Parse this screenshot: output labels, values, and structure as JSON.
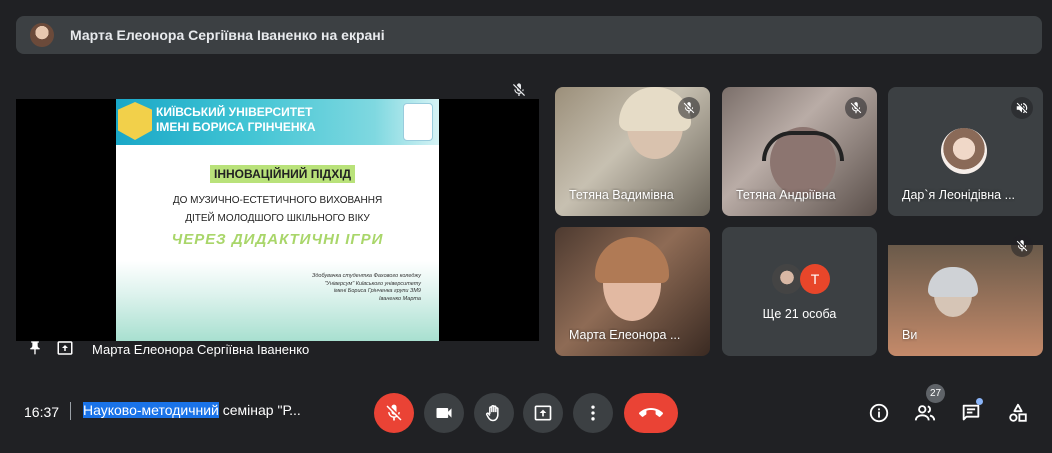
{
  "banner": {
    "text": "Марта Елеонора Сергіївна Іваненко на екрані"
  },
  "presentation": {
    "presenter_name": "Марта Елеонора Сергіївна Іваненко",
    "slide": {
      "university_line1": "КИЇВСЬКИЙ УНІВЕРСИТЕТ",
      "university_line2": "ІМЕНІ БОРИСА ГРІНЧЕНКА",
      "title": "ІННОВАЦІЙНИЙ ПІДХІД",
      "line1": "ДО МУЗИЧНО-ЕСТЕТИЧНОГО ВИХОВАННЯ",
      "line2": "ДІТЕЙ МОЛОДШОГО ШКІЛЬНОГО ВІКУ",
      "highlight": "ЧЕРЕЗ ДИДАКТИЧНІ ІГРИ",
      "note": "Здобувачка студентка Фахового коледжу \"Універсум\" Київського університету імені Бориса Грінченка групи ЗМ9 Іваненко Марта"
    }
  },
  "participants": [
    {
      "name": "Тетяна Вадимівна"
    },
    {
      "name": "Тетяна Андріївна"
    },
    {
      "name": "Дар`я Леонідівна ..."
    },
    {
      "name": "Марта Елеонора ..."
    },
    {
      "name": "Ще 21 особа",
      "avatar_letter": "T"
    },
    {
      "name": "Ви"
    }
  ],
  "bottom": {
    "time": "16:37",
    "title_highlight": "Науково-методичний",
    "title_rest": " семінар \"Р...",
    "participant_count": "27"
  },
  "colors": {
    "background": "#202124",
    "surface": "#3c4043",
    "danger": "#ea4335",
    "accent": "#1a73e8"
  }
}
